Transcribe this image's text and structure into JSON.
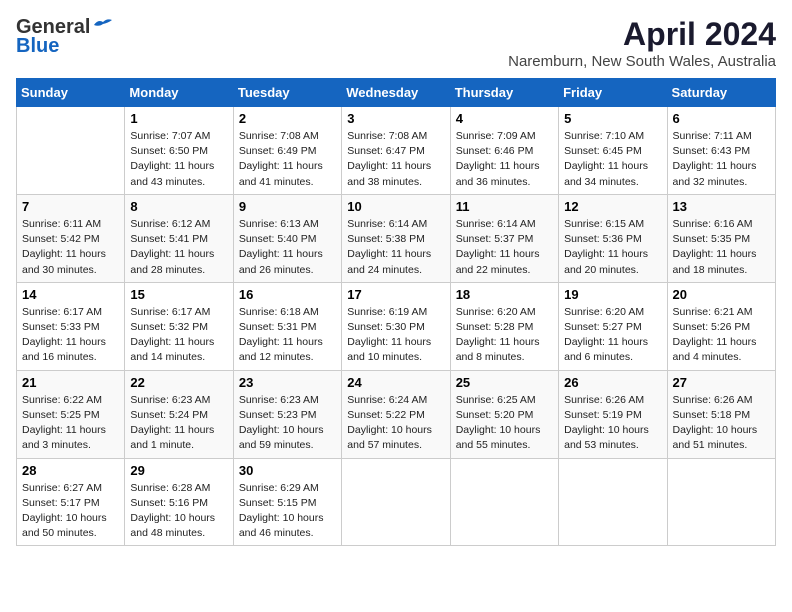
{
  "logo": {
    "general": "General",
    "blue": "Blue"
  },
  "title": "April 2024",
  "location": "Naremburn, New South Wales, Australia",
  "days_of_week": [
    "Sunday",
    "Monday",
    "Tuesday",
    "Wednesday",
    "Thursday",
    "Friday",
    "Saturday"
  ],
  "weeks": [
    [
      {
        "day": "",
        "info": ""
      },
      {
        "day": "1",
        "info": "Sunrise: 7:07 AM\nSunset: 6:50 PM\nDaylight: 11 hours\nand 43 minutes."
      },
      {
        "day": "2",
        "info": "Sunrise: 7:08 AM\nSunset: 6:49 PM\nDaylight: 11 hours\nand 41 minutes."
      },
      {
        "day": "3",
        "info": "Sunrise: 7:08 AM\nSunset: 6:47 PM\nDaylight: 11 hours\nand 38 minutes."
      },
      {
        "day": "4",
        "info": "Sunrise: 7:09 AM\nSunset: 6:46 PM\nDaylight: 11 hours\nand 36 minutes."
      },
      {
        "day": "5",
        "info": "Sunrise: 7:10 AM\nSunset: 6:45 PM\nDaylight: 11 hours\nand 34 minutes."
      },
      {
        "day": "6",
        "info": "Sunrise: 7:11 AM\nSunset: 6:43 PM\nDaylight: 11 hours\nand 32 minutes."
      }
    ],
    [
      {
        "day": "7",
        "info": "Sunrise: 6:11 AM\nSunset: 5:42 PM\nDaylight: 11 hours\nand 30 minutes."
      },
      {
        "day": "8",
        "info": "Sunrise: 6:12 AM\nSunset: 5:41 PM\nDaylight: 11 hours\nand 28 minutes."
      },
      {
        "day": "9",
        "info": "Sunrise: 6:13 AM\nSunset: 5:40 PM\nDaylight: 11 hours\nand 26 minutes."
      },
      {
        "day": "10",
        "info": "Sunrise: 6:14 AM\nSunset: 5:38 PM\nDaylight: 11 hours\nand 24 minutes."
      },
      {
        "day": "11",
        "info": "Sunrise: 6:14 AM\nSunset: 5:37 PM\nDaylight: 11 hours\nand 22 minutes."
      },
      {
        "day": "12",
        "info": "Sunrise: 6:15 AM\nSunset: 5:36 PM\nDaylight: 11 hours\nand 20 minutes."
      },
      {
        "day": "13",
        "info": "Sunrise: 6:16 AM\nSunset: 5:35 PM\nDaylight: 11 hours\nand 18 minutes."
      }
    ],
    [
      {
        "day": "14",
        "info": "Sunrise: 6:17 AM\nSunset: 5:33 PM\nDaylight: 11 hours\nand 16 minutes."
      },
      {
        "day": "15",
        "info": "Sunrise: 6:17 AM\nSunset: 5:32 PM\nDaylight: 11 hours\nand 14 minutes."
      },
      {
        "day": "16",
        "info": "Sunrise: 6:18 AM\nSunset: 5:31 PM\nDaylight: 11 hours\nand 12 minutes."
      },
      {
        "day": "17",
        "info": "Sunrise: 6:19 AM\nSunset: 5:30 PM\nDaylight: 11 hours\nand 10 minutes."
      },
      {
        "day": "18",
        "info": "Sunrise: 6:20 AM\nSunset: 5:28 PM\nDaylight: 11 hours\nand 8 minutes."
      },
      {
        "day": "19",
        "info": "Sunrise: 6:20 AM\nSunset: 5:27 PM\nDaylight: 11 hours\nand 6 minutes."
      },
      {
        "day": "20",
        "info": "Sunrise: 6:21 AM\nSunset: 5:26 PM\nDaylight: 11 hours\nand 4 minutes."
      }
    ],
    [
      {
        "day": "21",
        "info": "Sunrise: 6:22 AM\nSunset: 5:25 PM\nDaylight: 11 hours\nand 3 minutes."
      },
      {
        "day": "22",
        "info": "Sunrise: 6:23 AM\nSunset: 5:24 PM\nDaylight: 11 hours\nand 1 minute."
      },
      {
        "day": "23",
        "info": "Sunrise: 6:23 AM\nSunset: 5:23 PM\nDaylight: 10 hours\nand 59 minutes."
      },
      {
        "day": "24",
        "info": "Sunrise: 6:24 AM\nSunset: 5:22 PM\nDaylight: 10 hours\nand 57 minutes."
      },
      {
        "day": "25",
        "info": "Sunrise: 6:25 AM\nSunset: 5:20 PM\nDaylight: 10 hours\nand 55 minutes."
      },
      {
        "day": "26",
        "info": "Sunrise: 6:26 AM\nSunset: 5:19 PM\nDaylight: 10 hours\nand 53 minutes."
      },
      {
        "day": "27",
        "info": "Sunrise: 6:26 AM\nSunset: 5:18 PM\nDaylight: 10 hours\nand 51 minutes."
      }
    ],
    [
      {
        "day": "28",
        "info": "Sunrise: 6:27 AM\nSunset: 5:17 PM\nDaylight: 10 hours\nand 50 minutes."
      },
      {
        "day": "29",
        "info": "Sunrise: 6:28 AM\nSunset: 5:16 PM\nDaylight: 10 hours\nand 48 minutes."
      },
      {
        "day": "30",
        "info": "Sunrise: 6:29 AM\nSunset: 5:15 PM\nDaylight: 10 hours\nand 46 minutes."
      },
      {
        "day": "",
        "info": ""
      },
      {
        "day": "",
        "info": ""
      },
      {
        "day": "",
        "info": ""
      },
      {
        "day": "",
        "info": ""
      }
    ]
  ]
}
